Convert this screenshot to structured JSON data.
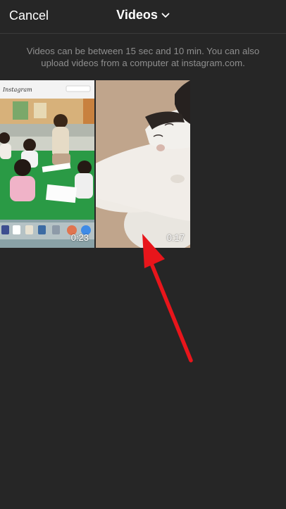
{
  "header": {
    "cancel_label": "Cancel",
    "title": "Videos"
  },
  "notice": "Videos can be between 15 sec and 10 min. You can also upload videos from a computer at instagram.com.",
  "videos": [
    {
      "duration": "0:23",
      "thumbnail": "classroom-screen-recording",
      "thumbnail_label": "Instagram"
    },
    {
      "duration": "0:17",
      "thumbnail": "sleeping-cat"
    }
  ],
  "annotation": {
    "arrow_color": "#e8151b"
  },
  "colors": {
    "background": "#262626",
    "text": "#ffffff",
    "muted_text": "#8e8e8e"
  }
}
